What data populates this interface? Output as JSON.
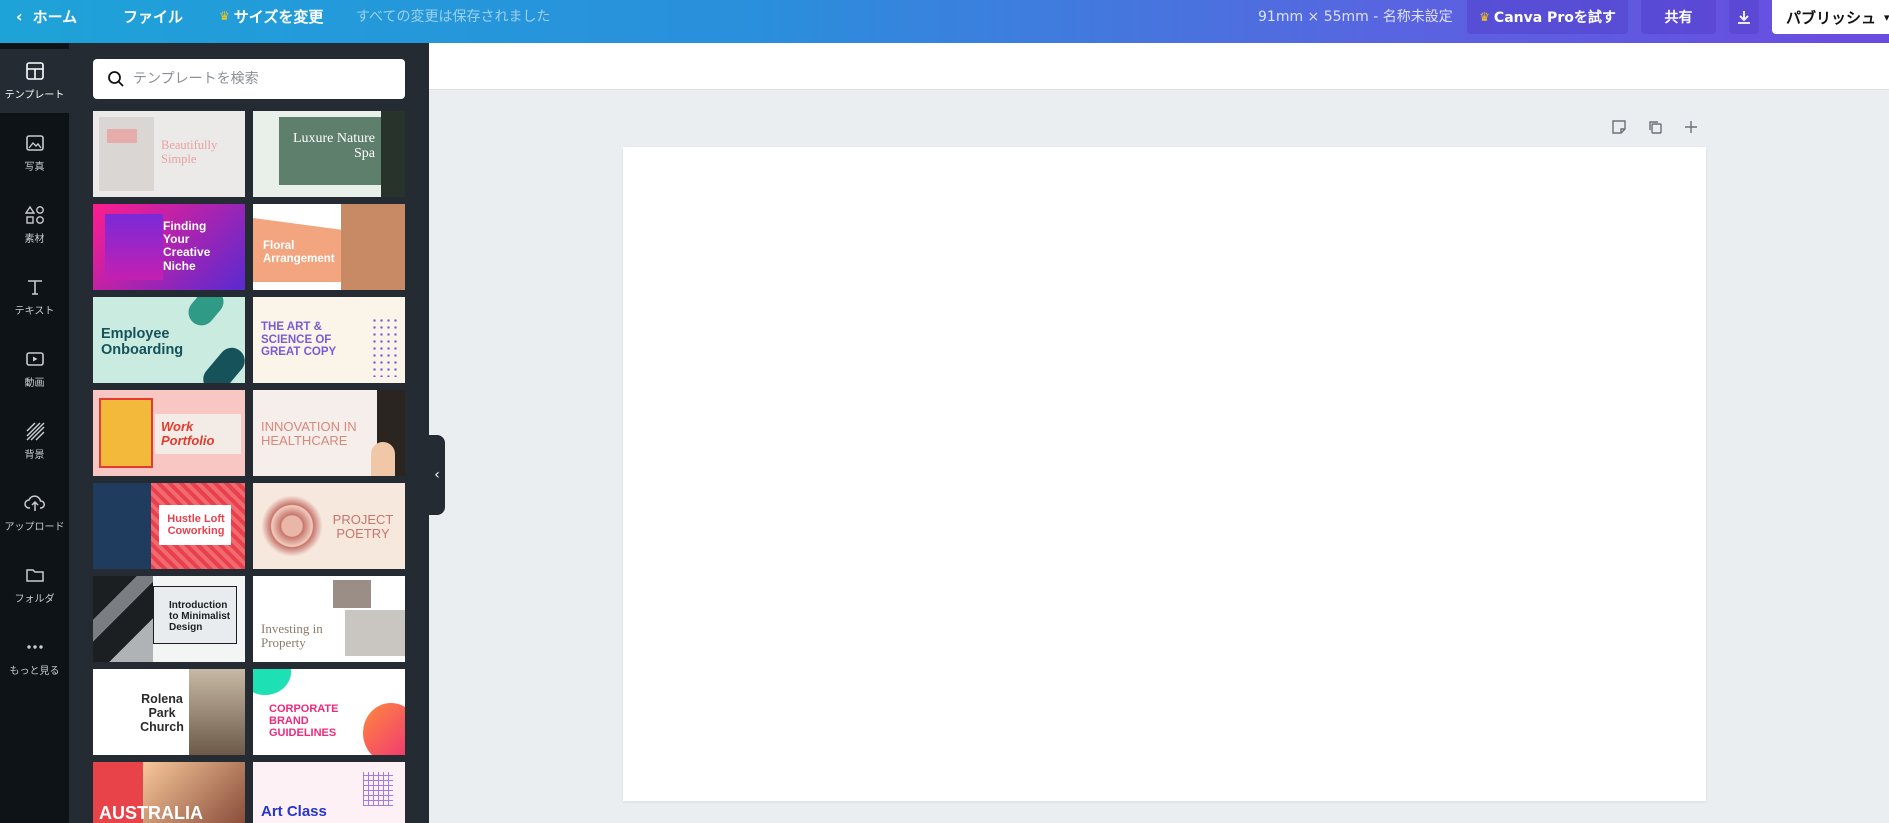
{
  "topbar": {
    "home_label": "ホーム",
    "file_label": "ファイル",
    "resize_label": "サイズを変更",
    "save_status": "すべての変更は保存されました",
    "design_size": "91mm × 55mm - 名称未設定",
    "pro_label": "Canva Proを試す",
    "share_label": "共有",
    "publish_label": "パブリッシュ"
  },
  "sidebar": {
    "items": [
      {
        "label": "テンプレート",
        "icon": "layout-icon"
      },
      {
        "label": "写真",
        "icon": "photo-icon"
      },
      {
        "label": "素材",
        "icon": "shapes-icon"
      },
      {
        "label": "テキスト",
        "icon": "text-icon"
      },
      {
        "label": "動画",
        "icon": "video-icon"
      },
      {
        "label": "背景",
        "icon": "background-icon"
      },
      {
        "label": "アップロード",
        "icon": "upload-icon"
      },
      {
        "label": "フォルダ",
        "icon": "folder-icon"
      },
      {
        "label": "もっと見る",
        "icon": "more-icon"
      }
    ]
  },
  "search": {
    "placeholder": "テンプレートを検索"
  },
  "templates": [
    {
      "title": "Beautifully Simple",
      "bg": "#eceae8",
      "accent": "#e7a19f"
    },
    {
      "title": "Luxure Nature Spa",
      "bg": "#e9efe9",
      "accent": "#5d7f6c"
    },
    {
      "title": "Finding Your Creative Niche",
      "bg": "#5a2ad0",
      "accent": "#ff1d8e"
    },
    {
      "title": "Floral Arrangement",
      "bg": "#f2a57f",
      "accent": "#ffffff"
    },
    {
      "title": "Employee Onboarding",
      "bg": "#c9ebe0",
      "accent": "#16525a"
    },
    {
      "title": "THE ART & SCIENCE OF GREAT COPY",
      "bg": "#fbf4e8",
      "accent": "#7b5ad6"
    },
    {
      "title": "Work Portfolio",
      "bg": "#f8c7c3",
      "accent": "#e23b2f"
    },
    {
      "title": "INNOVATION IN HEALTHCARE",
      "bg": "#f6eeeb",
      "accent": "#d8887a"
    },
    {
      "title": "Hustle Loft Coworking",
      "bg": "#1f3b5e",
      "accent": "#e9414b"
    },
    {
      "title": "PROJECT POETRY",
      "bg": "#f7e8de",
      "accent": "#c7766c"
    },
    {
      "title": "Introduction to Minimalist Design",
      "bg": "#f3f4f4",
      "accent": "#1c1f22"
    },
    {
      "title": "Investing in Property",
      "bg": "#ffffff",
      "accent": "#8b7b6a"
    },
    {
      "title": "Rolena Park Church",
      "bg": "#ffffff",
      "accent": "#2a2a2a"
    },
    {
      "title": "CORPORATE BRAND GUIDELINES",
      "bg": "#ffffff",
      "accent": "#ee2a7b"
    },
    {
      "title": "AUSTRALIA",
      "bg": "#e9434a",
      "accent": "#ffffff"
    },
    {
      "title": "Art Class",
      "bg": "#fdf1f5",
      "accent": "#2537c9"
    }
  ]
}
